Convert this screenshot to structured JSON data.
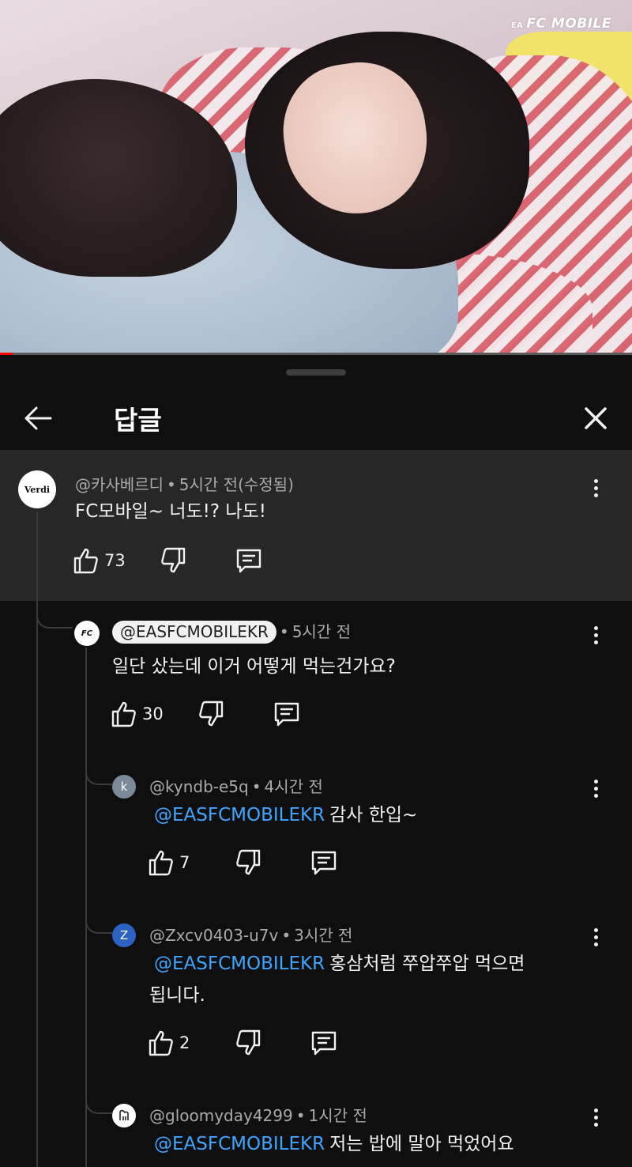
{
  "video": {
    "watermark_brand": "EA",
    "watermark_text": "FC MOBILE",
    "progress_fraction": 0.02
  },
  "header": {
    "title": "답글",
    "back_icon": "arrow-left-icon",
    "close_icon": "close-icon"
  },
  "parent_comment": {
    "avatar_text": "Verdi",
    "author": "@카사베르디",
    "time": "5시간 전(수정됨)",
    "text": "FC모바일~ 너도!? 나도!",
    "likes": "73"
  },
  "replies": [
    {
      "avatar_text": "FC",
      "author": "@EASFCMOBILEKR",
      "time": "5시간 전",
      "text": "일단 샀는데 이거 어떻게 먹는건가요?",
      "likes": "30"
    },
    {
      "avatar_text": "k",
      "avatar_color": "#7a8a99",
      "author": "@kyndb-e5q",
      "time": "4시간 전",
      "mention": "@EASFCMOBILEKR",
      "text": "감사 한입~",
      "likes": "7"
    },
    {
      "avatar_text": "Z",
      "avatar_color": "#2b62c4",
      "author": "@Zxcv0403-u7v",
      "time": "3시간 전",
      "mention": "@EASFCMOBILEKR",
      "text": "홍삼처럼 쭈압쭈압 먹으면",
      "text2": "됩니다.",
      "likes": "2"
    },
    {
      "avatar_text": "",
      "author": "@gloomyday4299",
      "time": "1시간 전",
      "mention": "@EASFCMOBILEKR",
      "text": "저는 밥에 말아 먹었어요"
    }
  ],
  "separator": "•"
}
